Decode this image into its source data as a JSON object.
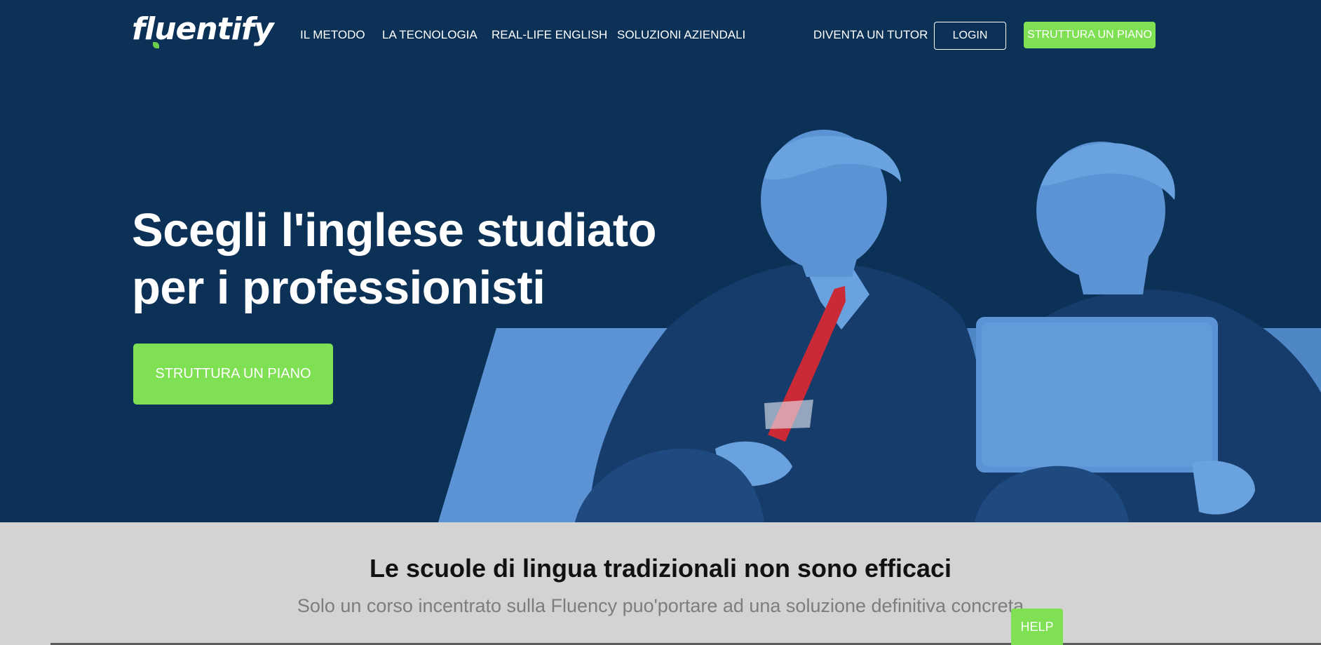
{
  "brand": {
    "name": "fluentify"
  },
  "nav": {
    "items": [
      {
        "label": "IL METODO"
      },
      {
        "label": "LA TECNOLOGIA"
      },
      {
        "label": "REAL-LIFE ENGLISH"
      },
      {
        "label": "SOLUZIONI AZIENDALI"
      }
    ],
    "tutor_label": "DIVENTA UN TUTOR",
    "login_label": "LOGIN",
    "cta_label": "STRUTTURA UN PIANO"
  },
  "hero": {
    "title_line1": "Scegli l'inglese studiato",
    "title_line2": "per i professionisti",
    "cta_label": "STRUTTURA UN PIANO",
    "image_subject": "two-businessmen-sofa-illustration"
  },
  "section": {
    "title": "Le scuole di lingua tradizionali non sono efficaci",
    "subtitle": "Solo un corso incentrato sulla Fluency puo'portare ad una soluzione definitiva concreta"
  },
  "help": {
    "label": "HELP"
  },
  "colors": {
    "hero_bg": "#0b3157",
    "illustration_blue": "#5b93d4",
    "accent_green": "#7ee052",
    "section_bg": "#d3d3d3",
    "section_sub": "#7d7d7d"
  }
}
